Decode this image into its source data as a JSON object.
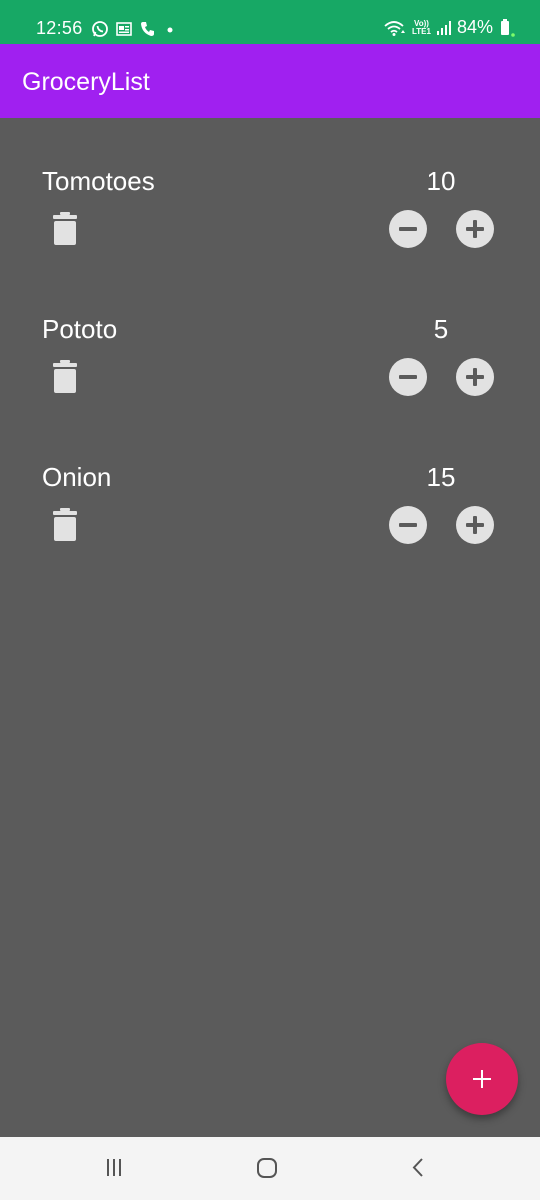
{
  "status_bar": {
    "time": "12:56",
    "battery": "84%",
    "volte_top": "Vo))",
    "volte_bottom": "LTE1",
    "bg_color": "#17a865"
  },
  "app_bar": {
    "title": "GroceryList",
    "bg_color": "#a020f0"
  },
  "items": [
    {
      "name": "Tomotoes",
      "quantity": "10"
    },
    {
      "name": "Pototo",
      "quantity": "5"
    },
    {
      "name": "Onion",
      "quantity": "15"
    }
  ],
  "icons": {
    "delete": "trash-icon",
    "decrement": "minus-circle-icon",
    "increment": "plus-circle-icon",
    "fab": "plus-icon"
  },
  "fab": {
    "color": "#dc1f60"
  },
  "nav_bar": {
    "buttons": [
      "recents",
      "home",
      "back"
    ]
  }
}
